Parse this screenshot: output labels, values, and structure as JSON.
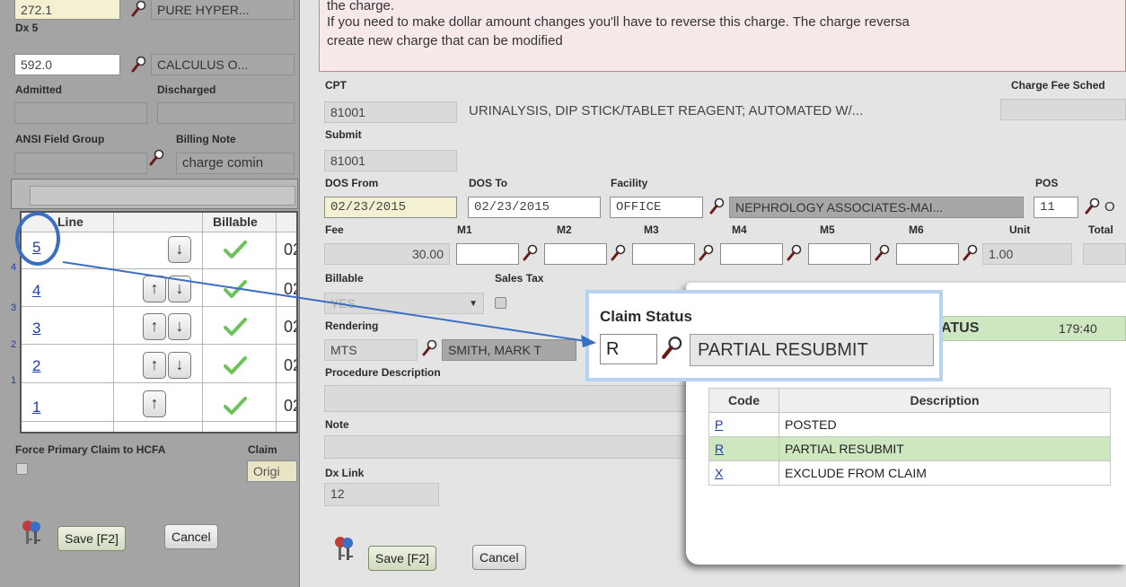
{
  "left_form": {
    "dx4_value": "272.1",
    "dx4_desc": "PURE HYPER...",
    "dx5_label": "Dx 5",
    "dx5_value": "592.0",
    "dx5_desc": "CALCULUS O...",
    "admitted_label": "Admitted",
    "discharged_label": "Discharged",
    "ansi_label": "ANSI Field Group",
    "billing_note_label": "Billing Note",
    "billing_note_value": "charge comin",
    "force_primary_label": "Force Primary Claim to HCFA",
    "claim_label": "Claim",
    "claim_value": "Origi",
    "save_label": "Save [F2]",
    "cancel_label": "Cancel"
  },
  "line_table": {
    "headers": {
      "line": "Line",
      "billable": "Billable"
    },
    "rows": [
      {
        "line": "5",
        "date": "02"
      },
      {
        "line": "4",
        "date": "02"
      },
      {
        "line": "3",
        "date": "02"
      },
      {
        "line": "2",
        "date": "02"
      },
      {
        "line": "1",
        "date": "02"
      }
    ]
  },
  "charge_modal": {
    "message_line1": "the charge.",
    "message_line2": "If you need to make dollar amount changes you'll have to reverse this charge. The charge reversa",
    "message_line3": "create new charge that can be modified",
    "cpt_label": "CPT",
    "cpt_value": "81001",
    "cpt_desc": "URINALYSIS, DIP STICK/TABLET REAGENT; AUTOMATED W/...",
    "fee_schedule_label": "Charge Fee Sched",
    "submit_label": "Submit",
    "submit_value": "81001",
    "dos_from_label": "DOS From",
    "dos_from_value": "02/23/2015",
    "dos_to_label": "DOS To",
    "dos_to_value": "02/23/2015",
    "facility_label": "Facility",
    "facility_value": "OFFICE",
    "facility_desc": "NEPHROLOGY ASSOCIATES-MAI...",
    "pos_label": "POS",
    "pos_value": "11",
    "pos_desc": "O",
    "fee_label": "Fee",
    "fee_value": "30.00",
    "m1_label": "M1",
    "m2_label": "M2",
    "m3_label": "M3",
    "m4_label": "M4",
    "m5_label": "M5",
    "m6_label": "M6",
    "unit_label": "Unit",
    "unit_value": "1.00",
    "total_label": "Total",
    "billable_label": "Billable",
    "billable_value": "YES",
    "sales_tax_label": "Sales Tax",
    "rendering_label": "Rendering",
    "rendering_value": "MTS",
    "rendering_desc": "SMITH, MARK T",
    "proc_desc_label": "Procedure Description",
    "note_label": "Note",
    "dx_link_label": "Dx Link",
    "dx_link_value": "12",
    "save_label": "Save [F2]",
    "cancel_label": "Cancel"
  },
  "status_popup": {
    "header_text": "ATUS",
    "header_value": "179:40",
    "columns": {
      "code": "Code",
      "description": "Description"
    },
    "rows": [
      {
        "code": "P",
        "description": "POSTED",
        "selected": false
      },
      {
        "code": "R",
        "description": "PARTIAL RESUBMIT",
        "selected": true
      },
      {
        "code": "X",
        "description": "EXCLUDE FROM CLAIM",
        "selected": false
      }
    ]
  },
  "callout": {
    "label": "Claim Status",
    "value": "R",
    "desc": "PARTIAL RESUBMIT"
  },
  "colors": {
    "accent_blue": "#3a6fc4",
    "selected_row": "#cfe7c0",
    "message_bg": "#f7e9e9",
    "callout_border": "#b9d3ee",
    "status_header": "#cfe7c0"
  }
}
